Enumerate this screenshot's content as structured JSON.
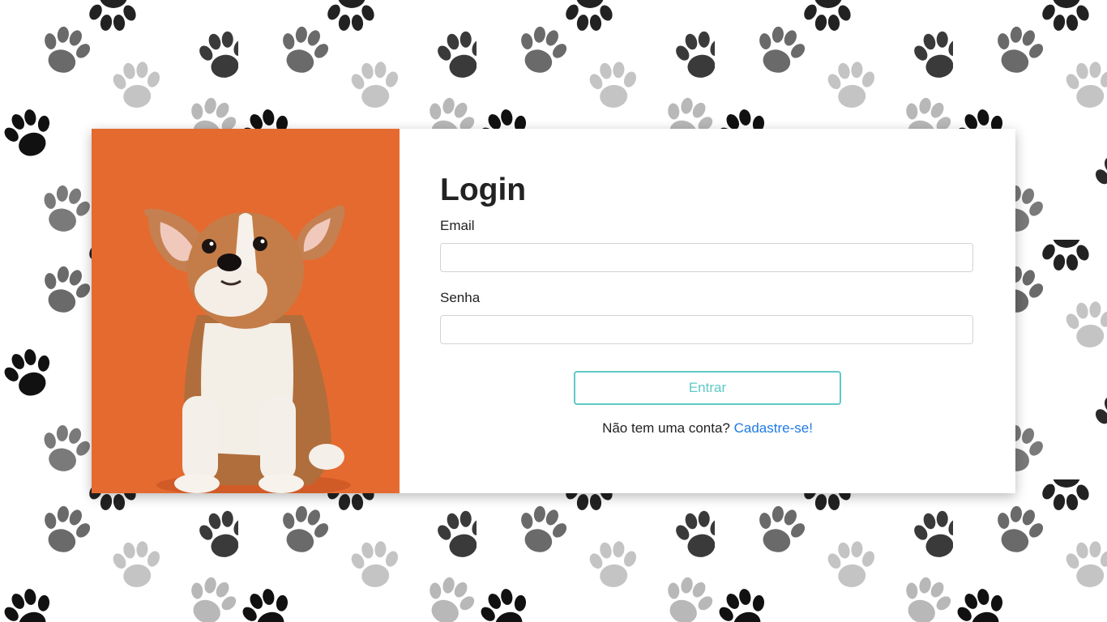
{
  "login": {
    "title": "Login",
    "email_label": "Email",
    "email_value": "",
    "password_label": "Senha",
    "password_value": "",
    "submit_label": "Entrar",
    "signup_prompt": "Não tem uma conta? ",
    "signup_link": "Cadastre-se!"
  },
  "colors": {
    "accent": "#5fcac5",
    "link": "#1f7be0",
    "photo_background": "#e2642c"
  },
  "icons": {
    "background_pattern": "paw-print-icon"
  }
}
